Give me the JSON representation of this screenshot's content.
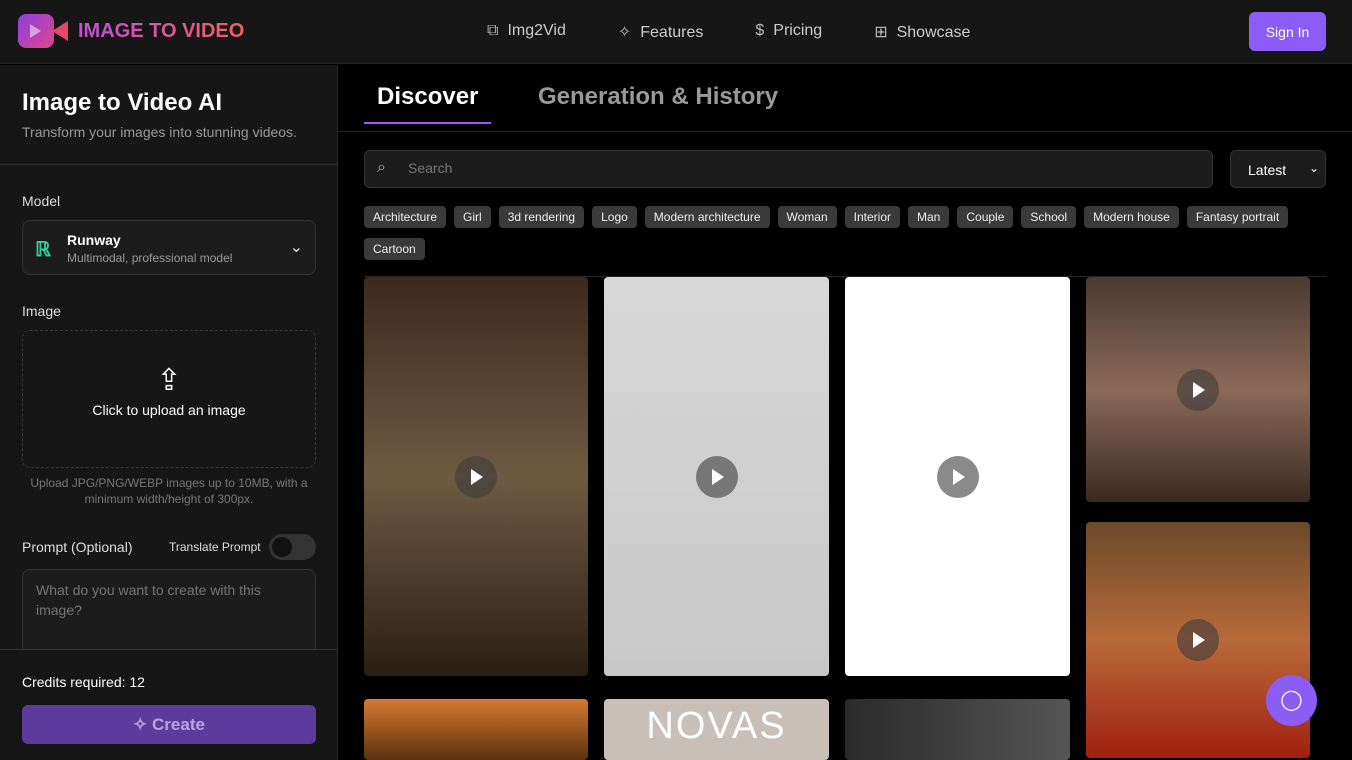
{
  "header": {
    "logo": "IMAGE TO VIDEO",
    "nav": [
      {
        "label": "Img2Vid",
        "icon": "play-square-icon"
      },
      {
        "label": "Features",
        "icon": "sparkles-icon"
      },
      {
        "label": "Pricing",
        "icon": "dollar-icon"
      },
      {
        "label": "Showcase",
        "icon": "grid-icon"
      }
    ],
    "signin": "Sign In"
  },
  "sidebar": {
    "title": "Image to Video AI",
    "subtitle": "Transform your images into stunning videos.",
    "model_label": "Model",
    "model_name": "Runway",
    "model_desc": "Multimodal, professional model",
    "image_label": "Image",
    "upload_text": "Click to upload an image",
    "upload_hint": "Upload JPG/PNG/WEBP images up to 10MB, with a minimum width/height of 300px.",
    "prompt_label": "Prompt (Optional)",
    "translate_label": "Translate Prompt",
    "translate_on": false,
    "prompt_placeholder": "What do you want to create with this image?",
    "credits": "Credits required: 12",
    "create": "Create"
  },
  "main": {
    "tabs": [
      "Discover",
      "Generation & History"
    ],
    "search_placeholder": "Search",
    "sort": "Latest",
    "tags": [
      "Architecture",
      "Girl",
      "3d rendering",
      "Logo",
      "Modern architecture",
      "Woman",
      "Interior",
      "Man",
      "Couple",
      "School",
      "Modern house",
      "Fantasy portrait",
      "Cartoon"
    ],
    "card_text": "NOVAS"
  },
  "colors": {
    "accent": "#8b5cf6"
  }
}
